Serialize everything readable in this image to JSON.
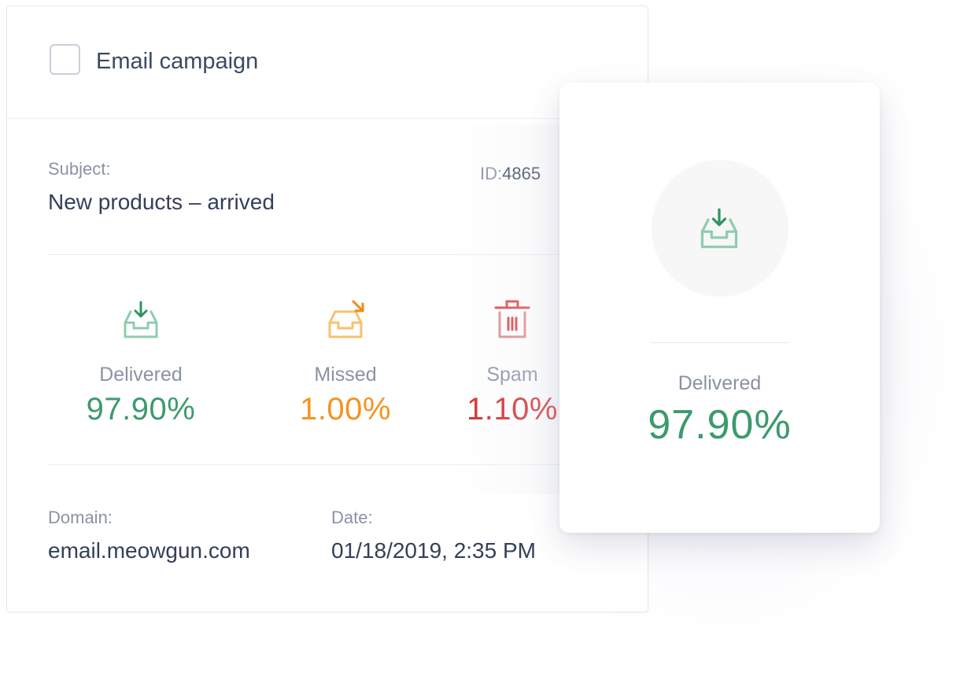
{
  "card": {
    "title": "Email campaign",
    "subject_label": "Subject:",
    "subject_value": "New products – arrived",
    "id_label": "ID:",
    "id_value": "4865",
    "stats": [
      {
        "icon": "inbox-download-icon",
        "label": "Delivered",
        "value": "97.90%",
        "color": "#3c9a6c"
      },
      {
        "icon": "inbox-missed-icon",
        "label": "Missed",
        "value": "1.00%",
        "color": "#f7921e"
      },
      {
        "icon": "trash-icon",
        "label": "Spam",
        "value": "1.10%",
        "color": "#d42a2a"
      }
    ],
    "domain_label": "Domain:",
    "domain_value": "email.meowgun.com",
    "date_label": "Date:",
    "date_value": "01/18/2019, 2:35 PM"
  },
  "popup": {
    "icon": "inbox-download-icon",
    "label": "Delivered",
    "value": "97.90%",
    "color": "#3c9a6c"
  },
  "colors": {
    "delivered": "#3c9a6c",
    "missed": "#f7921e",
    "spam": "#d42a2a"
  }
}
